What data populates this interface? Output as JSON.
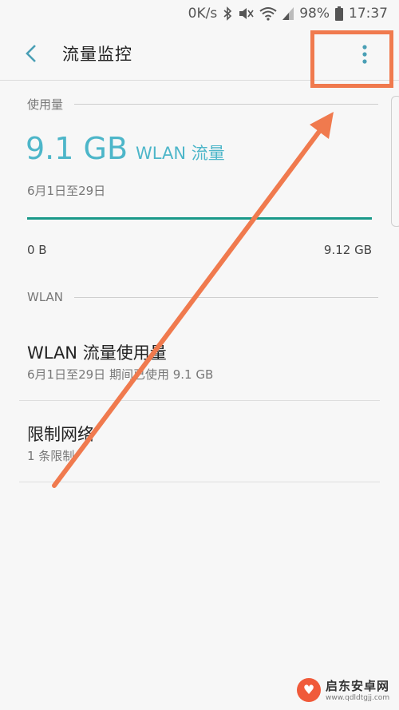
{
  "status_bar": {
    "speed": "0K/s",
    "battery": "98%",
    "time": "17:37"
  },
  "app_bar": {
    "title": "流量监控"
  },
  "usage_section": {
    "header": "使用量",
    "value": "9.1 GB",
    "unit_label": "WLAN 流量",
    "date_range": "6月1日至29日",
    "bar_min": "0 B",
    "bar_max": "9.12 GB",
    "bar_fill_fraction": 1.0
  },
  "wlan_section": {
    "header": "WLAN",
    "items": [
      {
        "title": "WLAN 流量使用量",
        "subtitle": "6月1日至29日 期间已使用 9.1 GB"
      },
      {
        "title": "限制网络",
        "subtitle": "1 条限制"
      }
    ]
  },
  "watermark": {
    "name": "启东安卓网",
    "url": "www.qdldtgjj.com"
  },
  "colors": {
    "accent": "#4db6c9",
    "bar_fill": "#1a9989",
    "annotation": "#f07a4e"
  },
  "icons": [
    "wifi-icon",
    "bluetooth-icon",
    "mute-icon",
    "signal-icon",
    "battery-icon",
    "back-arrow-icon",
    "more-vert-icon"
  ]
}
